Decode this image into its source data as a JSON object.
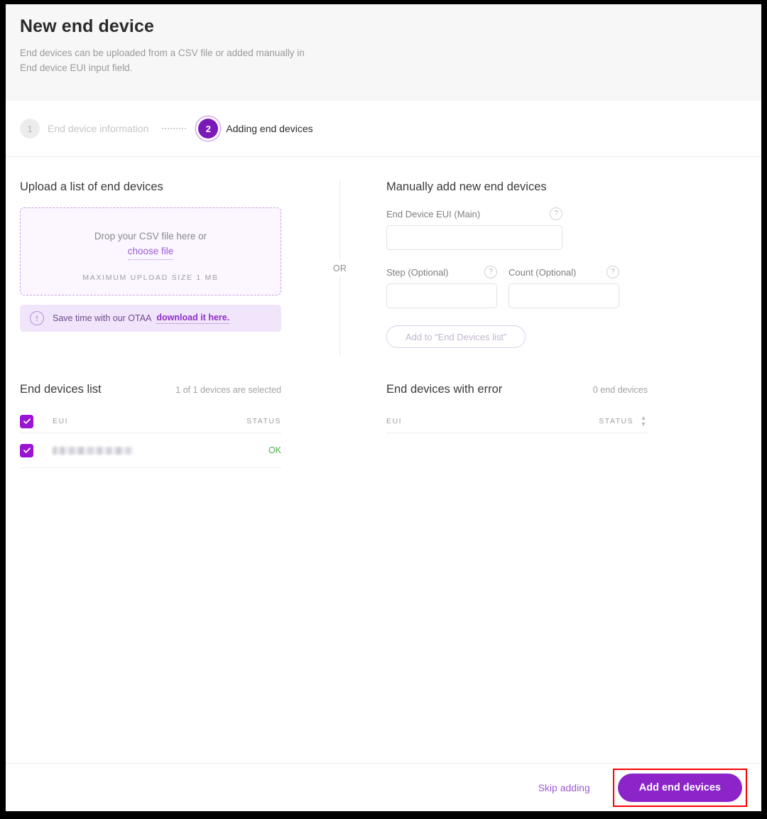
{
  "header": {
    "title": "New end device",
    "subtitle": "End devices can be uploaded from a CSV file or added manually in\nEnd device EUI input field."
  },
  "stepper": {
    "steps": [
      {
        "number": "1",
        "label": "End device information",
        "state": "inactive"
      },
      {
        "number": "2",
        "label": "Adding end devices",
        "state": "active"
      }
    ]
  },
  "upload": {
    "section_title": "Upload a list of end devices",
    "drop_text": "Drop your CSV file here or",
    "choose_file_label": "choose file",
    "max_size_label": "MAXIMUM UPLOAD SIZE 1 MB",
    "notice": {
      "icon": "exclamation-circle-icon",
      "text": "Save time with our OTAA",
      "link_label": "download it here."
    }
  },
  "divider": {
    "or_label": "OR"
  },
  "manual": {
    "section_title": "Manually add new end devices",
    "fields": [
      {
        "label": "End Device EUI (Main)",
        "value": "",
        "placeholder": "",
        "help": "?"
      },
      {
        "label": "Step (Optional)",
        "value": "",
        "placeholder": "",
        "help": "?"
      },
      {
        "label": "Count (Optional)",
        "value": "",
        "placeholder": "",
        "help": "?"
      }
    ],
    "add_button_label": "Add to “End Devices list”"
  },
  "devices_list": {
    "title": "End devices list",
    "count_text": "1 of 1 devices are selected",
    "columns": [
      "EUI",
      "STATUS"
    ],
    "header_checkbox_checked": true,
    "rows": [
      {
        "checked": true,
        "eui": "",
        "eui_redacted": true,
        "status": "OK"
      }
    ]
  },
  "devices_error": {
    "title": "End devices with error",
    "count_text": "0 end devices",
    "columns": [
      "EUI",
      "STATUS"
    ],
    "sort_icon": "sort-chevron-icon",
    "rows": []
  },
  "footer": {
    "skip_label": "Skip adding",
    "primary_label": "Add end devices"
  },
  "colors": {
    "brand_purple": "#8c24c9",
    "step_active": "#7b18b8",
    "checkbox_purple": "#9b14d4",
    "link_purple": "#9d5ad6",
    "notice_bg": "#f1e5fb",
    "dropzone_bg": "#fbf6ff",
    "status_ok_green": "#4cb050",
    "highlight_red": "#fb0000",
    "header_bg": "#f7f7f7"
  }
}
